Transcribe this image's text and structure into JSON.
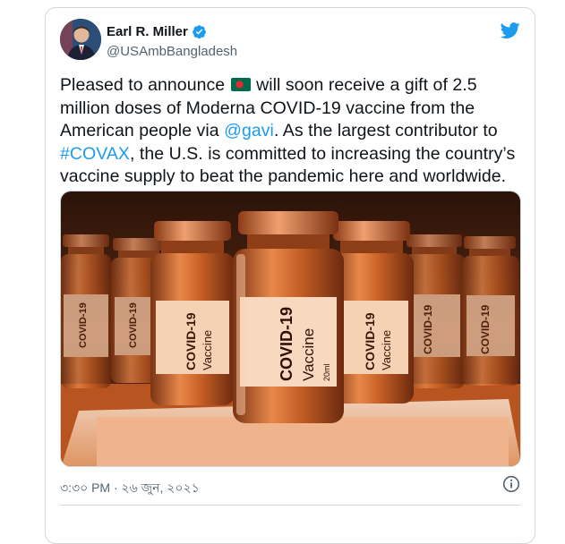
{
  "author": {
    "name": "Earl R. Miller",
    "handle": "@USAmbBangladesh",
    "verified": true
  },
  "tweet": {
    "text_1": "Pleased to announce ",
    "flag_icon": "bangladesh-flag-emoji",
    "text_2": " will soon receive a gift of 2.5 million doses of Moderna COVID-19 vaccine from the American people via ",
    "mention": "@gavi",
    "text_3": ". As the largest contributor to ",
    "hashtag": "#COVAX",
    "text_4": ", the U.S. is committed to increasing the country’s vaccine supply to beat the pandemic here and worldwide."
  },
  "media": {
    "vial_label_line1": "COVID-19",
    "vial_label_line2": "Vaccine",
    "vial_label_small": "20ml"
  },
  "timestamp": "৩:৩০ PM · ২৬ জুন, ২০২১",
  "colors": {
    "link": "#1d9bf0",
    "twitter_blue": "#1d9bf0",
    "photo_tint": "#c8551c"
  }
}
